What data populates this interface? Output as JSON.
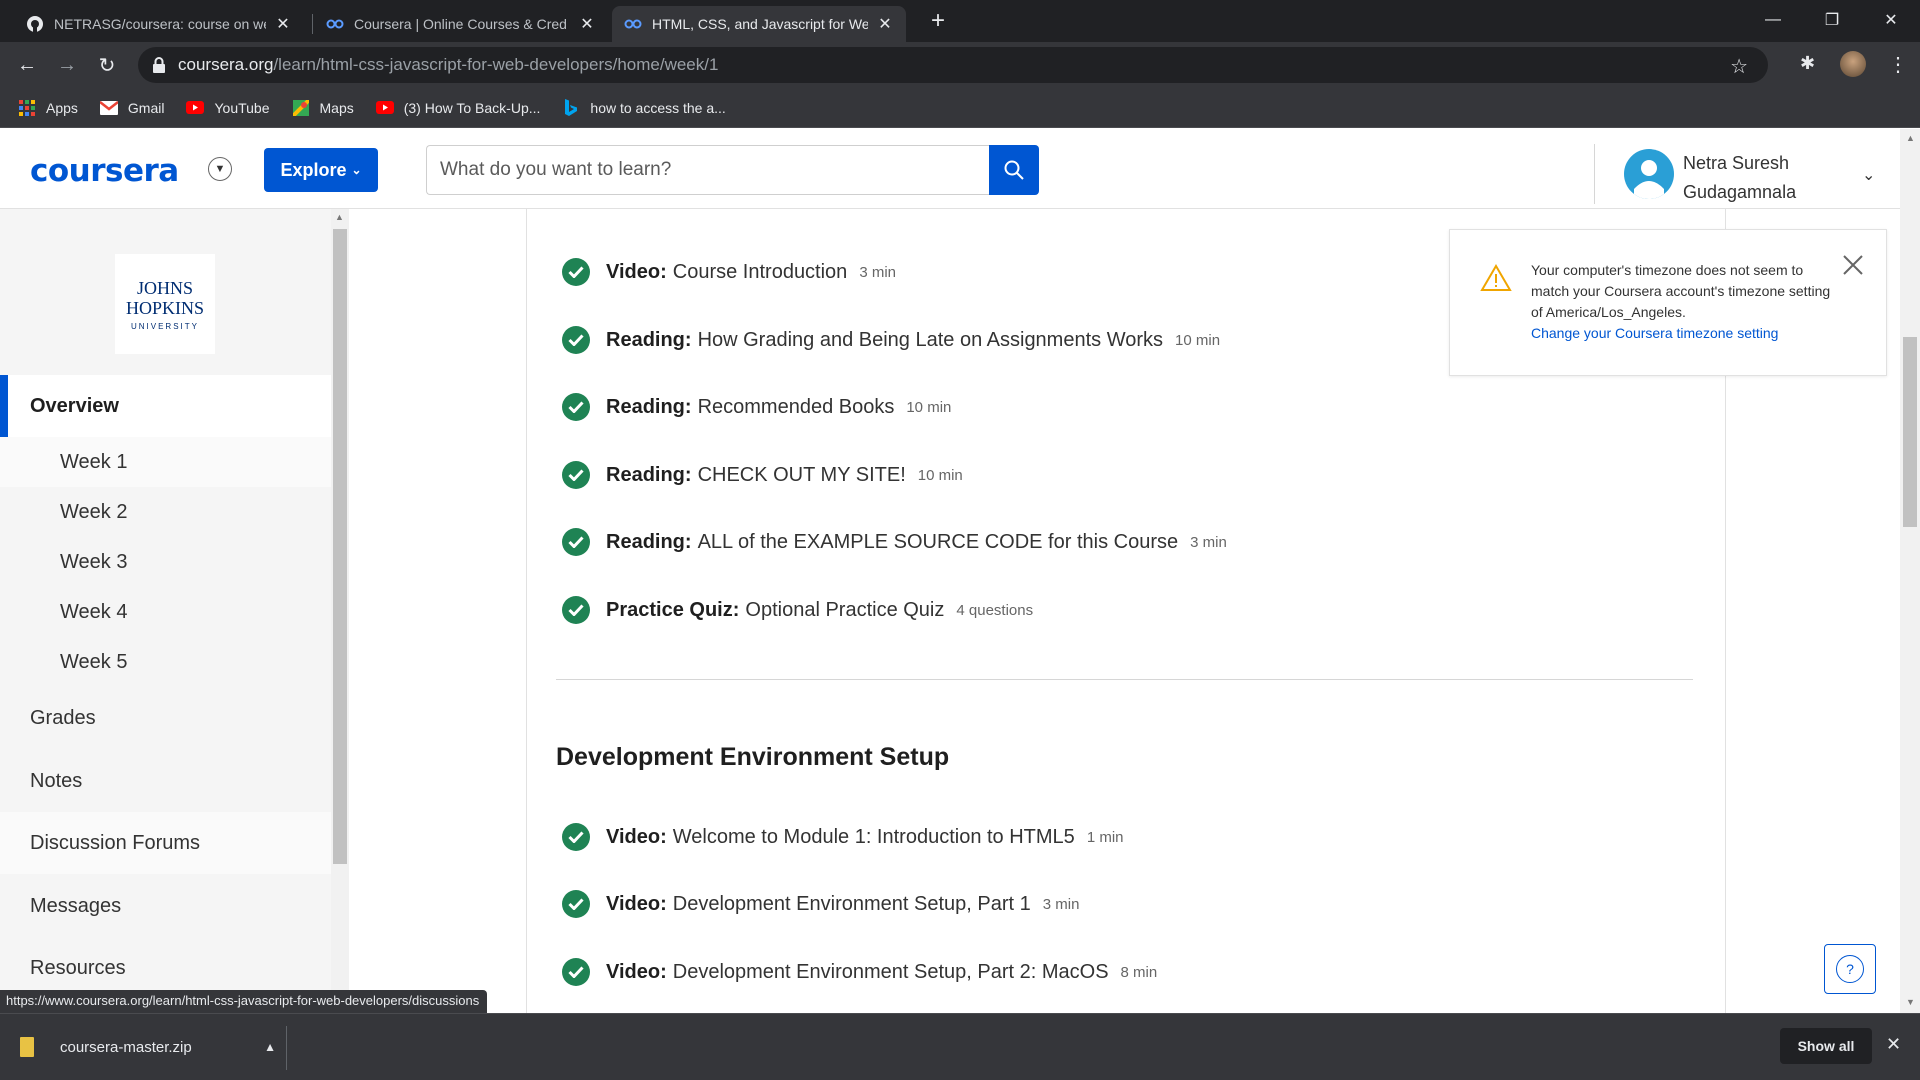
{
  "browser": {
    "tabs": [
      {
        "title": "NETRASG/coursera: course on we",
        "icon": "github-icon"
      },
      {
        "title": "Coursera | Online Courses & Cred",
        "icon": "coursera-icon"
      },
      {
        "title": "HTML, CSS, and Javascript for We",
        "icon": "coursera-icon"
      }
    ],
    "url_host": "coursera.org",
    "url_path": "/learn/html-css-javascript-for-web-developers/home/week/1",
    "bookmarks": [
      {
        "label": "Apps",
        "icon": "apps-grid-icon"
      },
      {
        "label": "Gmail",
        "icon": "gmail-icon"
      },
      {
        "label": "YouTube",
        "icon": "youtube-icon"
      },
      {
        "label": "Maps",
        "icon": "maps-icon"
      },
      {
        "label": "(3) How To Back-Up...",
        "icon": "youtube-icon"
      },
      {
        "label": "how to access the a...",
        "icon": "bing-icon"
      }
    ]
  },
  "header": {
    "logo": "coursera",
    "explore_label": "Explore",
    "search_placeholder": "What do you want to learn?",
    "user_first": "Netra Suresh",
    "user_last": "Gudagamnala"
  },
  "sidebar": {
    "university": {
      "line1": "JOHNS",
      "line2": "HOPKINS",
      "line3": "UNIVERSITY"
    },
    "overview": "Overview",
    "weeks": [
      "Week 1",
      "Week 2",
      "Week 3",
      "Week 4",
      "Week 5"
    ],
    "items": [
      "Grades",
      "Notes",
      "Discussion Forums",
      "Messages",
      "Resources"
    ]
  },
  "lessons_top": [
    {
      "type": "Video:",
      "title": "Course Introduction",
      "meta": "3 min"
    },
    {
      "type": "Reading:",
      "title": "How Grading and Being Late on Assignments Works",
      "meta": "10 min"
    },
    {
      "type": "Reading:",
      "title": "Recommended Books",
      "meta": "10 min"
    },
    {
      "type": "Reading:",
      "title": "CHECK OUT MY SITE!",
      "meta": "10 min"
    },
    {
      "type": "Reading:",
      "title": "ALL of the EXAMPLE SOURCE CODE for this Course",
      "meta": "3 min"
    },
    {
      "type": "Practice Quiz:",
      "title": "Optional Practice Quiz",
      "meta": "4 questions"
    }
  ],
  "section_title": "Development Environment Setup",
  "lessons_section": [
    {
      "type": "Video:",
      "title": "Welcome to Module 1: Introduction to HTML5",
      "meta": "1 min"
    },
    {
      "type": "Video:",
      "title": "Development Environment Setup, Part 1",
      "meta": "3 min"
    },
    {
      "type": "Video:",
      "title": "Development Environment Setup, Part 2: MacOS",
      "meta": "8 min"
    }
  ],
  "timezone_notice": {
    "message": "Your computer's timezone does not seem to match your Coursera account's timezone setting of America/Los_Angeles.",
    "link": "Change your Coursera timezone setting"
  },
  "help_label": "?",
  "status_url": "https://www.coursera.org/learn/html-css-javascript-for-web-developers/discussions",
  "download": {
    "file": "coursera-master.zip",
    "show_all": "Show all"
  },
  "colors": {
    "brand": "#0056d2",
    "complete": "#1f8354",
    "warning": "#f0a500"
  }
}
